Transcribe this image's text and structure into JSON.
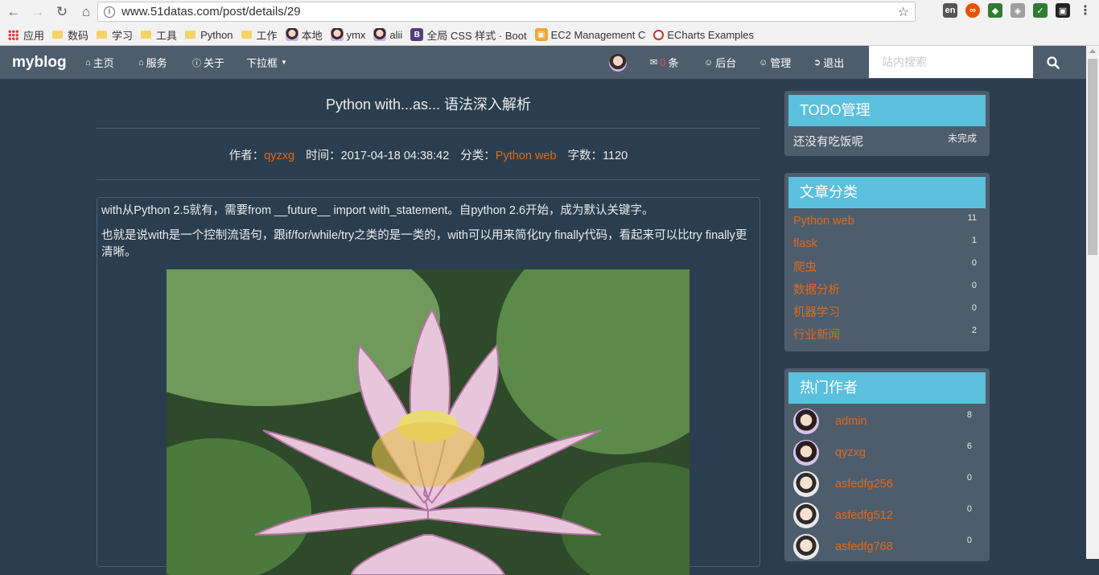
{
  "browser": {
    "url": "www.51datas.com/post/details/29",
    "bookmarks": [
      {
        "label": "应用",
        "kind": "apps"
      },
      {
        "label": "数码",
        "kind": "folder"
      },
      {
        "label": "学习",
        "kind": "folder"
      },
      {
        "label": "工具",
        "kind": "folder"
      },
      {
        "label": "Python",
        "kind": "folder"
      },
      {
        "label": "工作",
        "kind": "folder"
      },
      {
        "label": "本地",
        "kind": "avatar"
      },
      {
        "label": "ymx",
        "kind": "avatar"
      },
      {
        "label": "alii",
        "kind": "avatar"
      },
      {
        "label": "全局 CSS 样式 · Boot",
        "kind": "bootstrap"
      },
      {
        "label": "EC2 Management C",
        "kind": "aws"
      },
      {
        "label": "ECharts Examples",
        "kind": "echarts"
      }
    ]
  },
  "navbar": {
    "brand": "myblog",
    "home": "主页",
    "services": "服务",
    "about": "关于",
    "dropdown": "下拉框",
    "messages_count": "0",
    "messages_unit": "条",
    "backend": "后台",
    "manage": "管理",
    "logout": "退出",
    "search_placeholder": "站内搜索"
  },
  "article": {
    "title": "Python with...as... 语法深入解析",
    "author_label": "作者：",
    "author": "qyzxg",
    "time_label": "时间：",
    "time": "2017-04-18 04:38:42",
    "category_label": "分类：",
    "category": "Python web",
    "words_label": "字数：",
    "words": "1120",
    "paragraphs": [
      "with从Python 2.5就有，需要from __future__ import with_statement。自python 2.6开始，成为默认关键字。",
      "也就是说with是一个控制流语句，跟if/for/while/try之类的是一类的，with可以用来简化try finally代码，看起来可以比try finally更清晰。"
    ]
  },
  "todo": {
    "title": "TODO管理",
    "items": [
      {
        "text": "还没有吃饭呢",
        "status": "未完成"
      }
    ]
  },
  "categories": {
    "title": "文章分类",
    "items": [
      {
        "name": "Python web",
        "count": "11"
      },
      {
        "name": "flask",
        "count": "1"
      },
      {
        "name": "爬虫",
        "count": "0"
      },
      {
        "name": "数据分析",
        "count": "0"
      },
      {
        "name": "机器学习",
        "count": "0"
      },
      {
        "name": "行业新闻",
        "count": "2"
      }
    ]
  },
  "authors": {
    "title": "热门作者",
    "items": [
      {
        "name": "admin",
        "count": "8"
      },
      {
        "name": "qyzxg",
        "count": "6"
      },
      {
        "name": "asfedfg256",
        "count": "0"
      },
      {
        "name": "asfedfg512",
        "count": "0"
      },
      {
        "name": "asfedfg768",
        "count": "0"
      }
    ]
  },
  "colors": {
    "page_bg": "#2b3e50",
    "navbar_bg": "#4e5d6c",
    "accent": "#df691a",
    "panel_header": "#5bc0de"
  }
}
